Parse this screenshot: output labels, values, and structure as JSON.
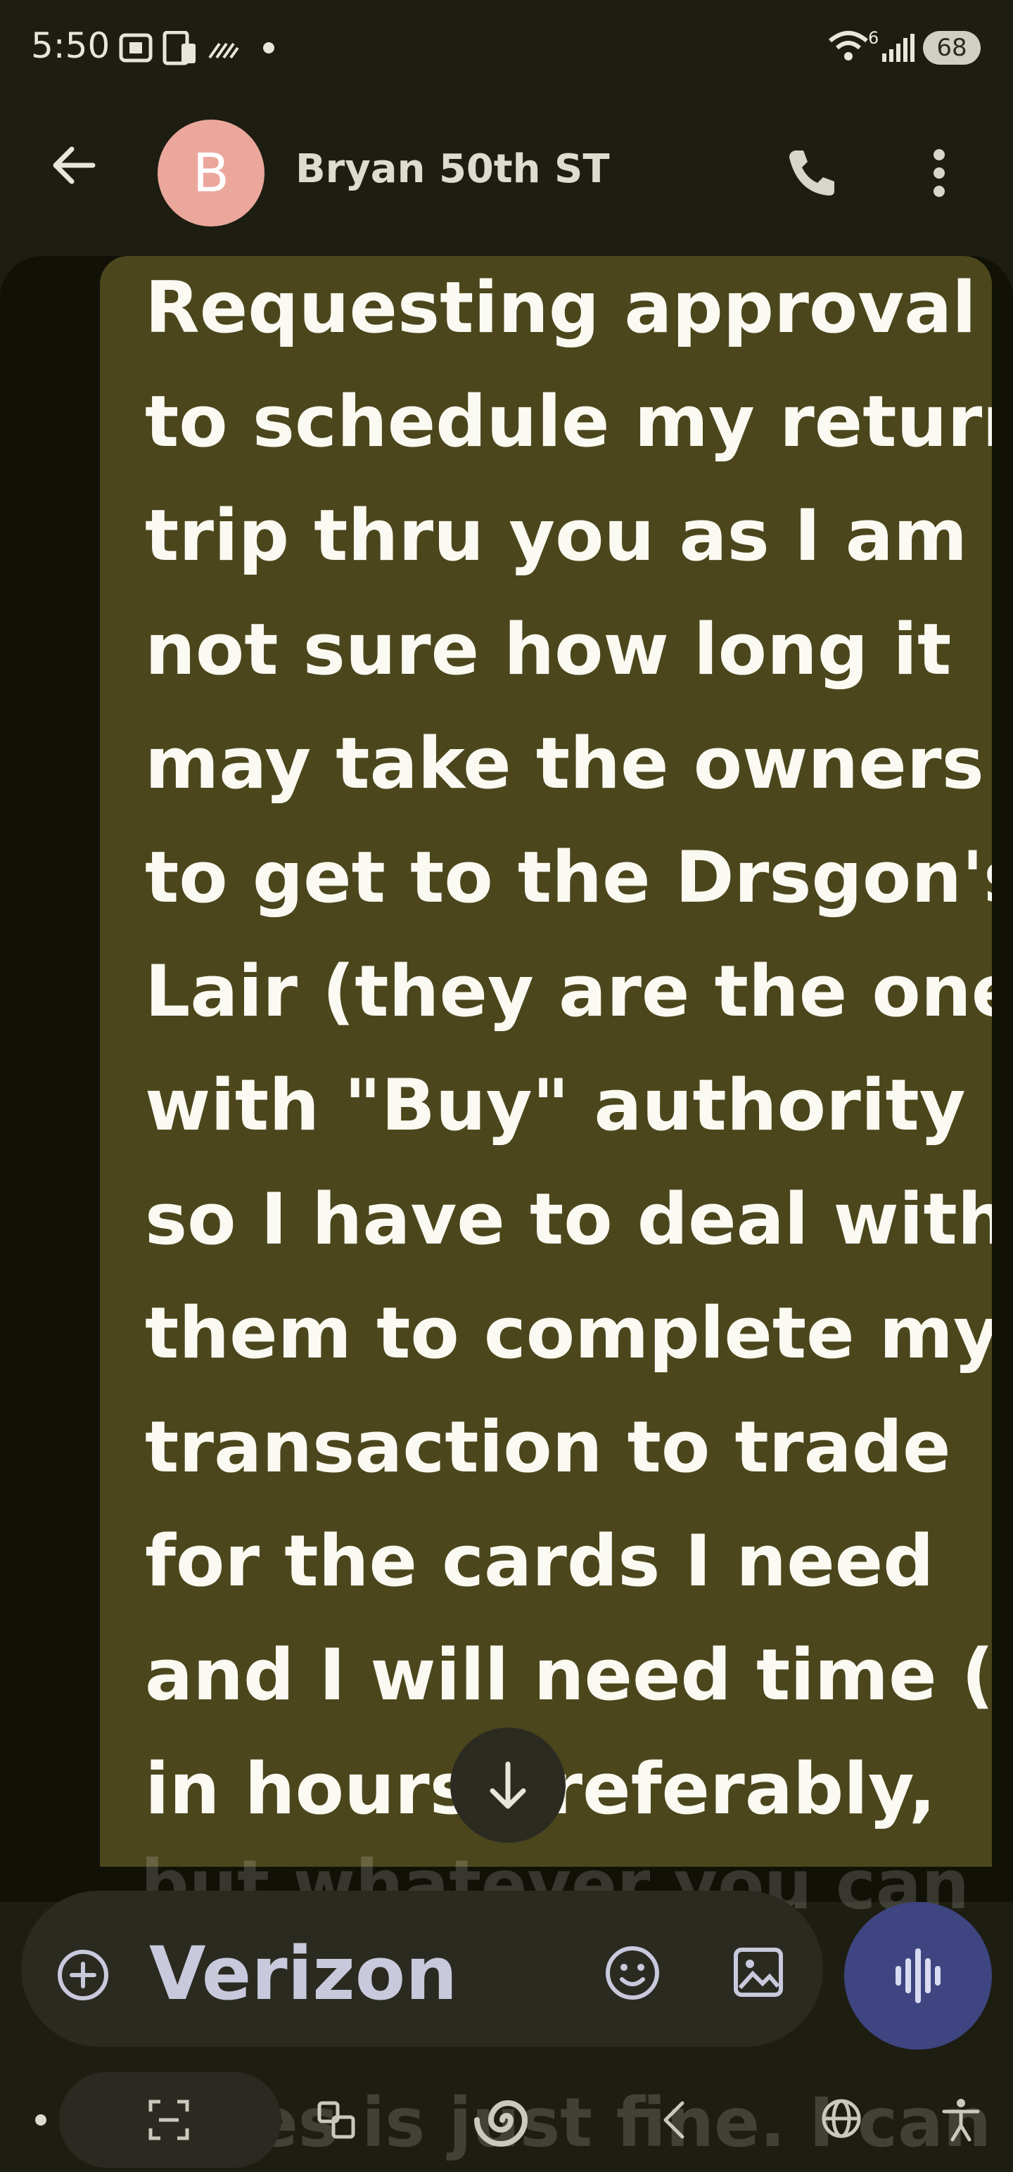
{
  "status_bar": {
    "time": "5:50",
    "wifi_sup": "6",
    "battery": "68",
    "icons": [
      "screenshot-icon",
      "phone-sync-icon",
      "data-saver-icon",
      "dot-icon",
      "wifi-icon",
      "signal-icon",
      "battery-icon"
    ]
  },
  "header": {
    "avatar_letter": "B",
    "contact_name": "Bryan 50th ST",
    "colors": {
      "avatar": "#eba79c"
    }
  },
  "message": {
    "lines": [
      "Requesting approval",
      "to schedule my return",
      "trip thru you as I am",
      "not sure how long it",
      "may take the owners",
      "to get to the Drsgon's",
      "Lair (they are the ones",
      "with \"Buy\" authority",
      "so I have to deal with",
      "them to complete my",
      "transaction to trade",
      "for the cards I need",
      "and I will need time (as",
      "in hours preferably,"
    ],
    "faded_lines": [
      "but whatever you can",
      "rules is just fine. I can"
    ],
    "colors": {
      "bubble": "#4c461c",
      "text": "#fbfaf2"
    }
  },
  "composer": {
    "placeholder": "Verizon",
    "colors": {
      "mic_button": "#3e4581"
    }
  },
  "nav_bar": {
    "icons": [
      "scan-icon",
      "translate-icon",
      "swirl-icon",
      "back-icon",
      "globe-icon",
      "accessibility-icon"
    ]
  }
}
